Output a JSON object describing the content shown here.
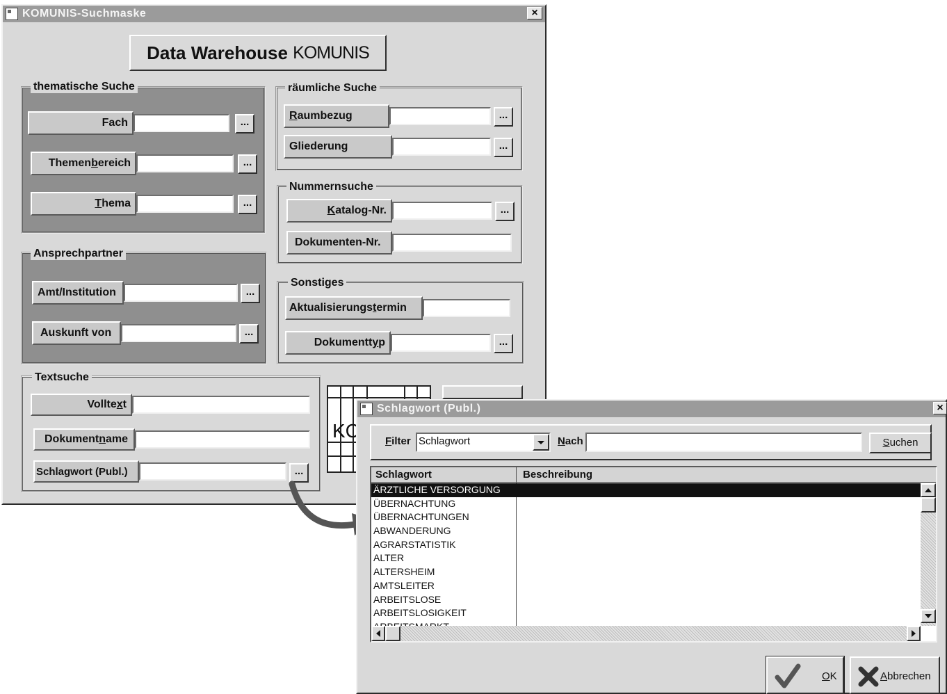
{
  "main_window": {
    "title": "KOMUNIS-Suchmaske",
    "close_label": "×",
    "banner_text": "Data Warehouse ",
    "banner_logo": "KOMUNIS",
    "groups": {
      "thematisch": {
        "label": "thematische Suche",
        "fields": [
          {
            "label_pre": "Fach",
            "label_u": "",
            "label_post": ""
          },
          {
            "label_pre": "Themen",
            "label_u": "b",
            "label_post": "ereich"
          },
          {
            "label_pre": "",
            "label_u": "T",
            "label_post": "hema"
          }
        ]
      },
      "ansprech": {
        "label": "Ansprechpartner",
        "fields": [
          {
            "label_pre": "Amt/Institution",
            "label_u": "",
            "label_post": ""
          },
          {
            "label_pre": "Auskunft von",
            "label_u": "",
            "label_post": ""
          }
        ]
      },
      "textsuche": {
        "label": "Textsuche",
        "fields": [
          {
            "label_pre": "Vollte",
            "label_u": "x",
            "label_post": "t"
          },
          {
            "label_pre": "Dokument",
            "label_u": "n",
            "label_post": "ame"
          },
          {
            "label_pre": "Schlagwort (Publ.)",
            "label_u": "",
            "label_post": ""
          }
        ]
      },
      "raeumlich": {
        "label": "räumliche Suche",
        "fields": [
          {
            "label_pre": "",
            "label_u": "R",
            "label_post": "aumbezug"
          },
          {
            "label_pre": "Gliederung",
            "label_u": "",
            "label_post": ""
          }
        ]
      },
      "nummern": {
        "label": "Nummernsuche",
        "fields": [
          {
            "label_pre": "",
            "label_u": "K",
            "label_post": "atalog-Nr."
          },
          {
            "label_pre": "Dokumenten-Nr.",
            "label_u": "",
            "label_post": ""
          }
        ]
      },
      "sonstiges": {
        "label": "Sonstiges",
        "fields": [
          {
            "label_pre": "Aktualisierungs",
            "label_u": "t",
            "label_post": "ermin"
          },
          {
            "label_pre": "Dokumentt",
            "label_u": "y",
            "label_post": "p"
          }
        ]
      }
    },
    "dots_label": "...",
    "partial_logo_text": "KC"
  },
  "dialog": {
    "title": "Schlagwort (Publ.)",
    "close_label": "×",
    "filter_label_u": "F",
    "filter_label_rest": "ilter",
    "filter_value": "Schlagwort",
    "nach_label_u": "N",
    "nach_label_rest": "ach",
    "nach_value": "",
    "suchen_u": "S",
    "suchen_rest": "uchen",
    "columns": [
      "Schlagwort",
      "Beschreibung"
    ],
    "rows": [
      "ÄRZTLICHE VERSORGUNG",
      "ÜBERNACHTUNG",
      "ÜBERNACHTUNGEN",
      "ABWANDERUNG",
      "AGRARSTATISTIK",
      "ALTER",
      "ALTERSHEIM",
      "AMTSLEITER",
      "ARBEITSLOSE",
      "ARBEITSLOSIGKEIT",
      "ARBEITSMARKT"
    ],
    "ok_u": "O",
    "ok_rest": "K",
    "cancel_u": "A",
    "cancel_rest": "bbrechen"
  }
}
